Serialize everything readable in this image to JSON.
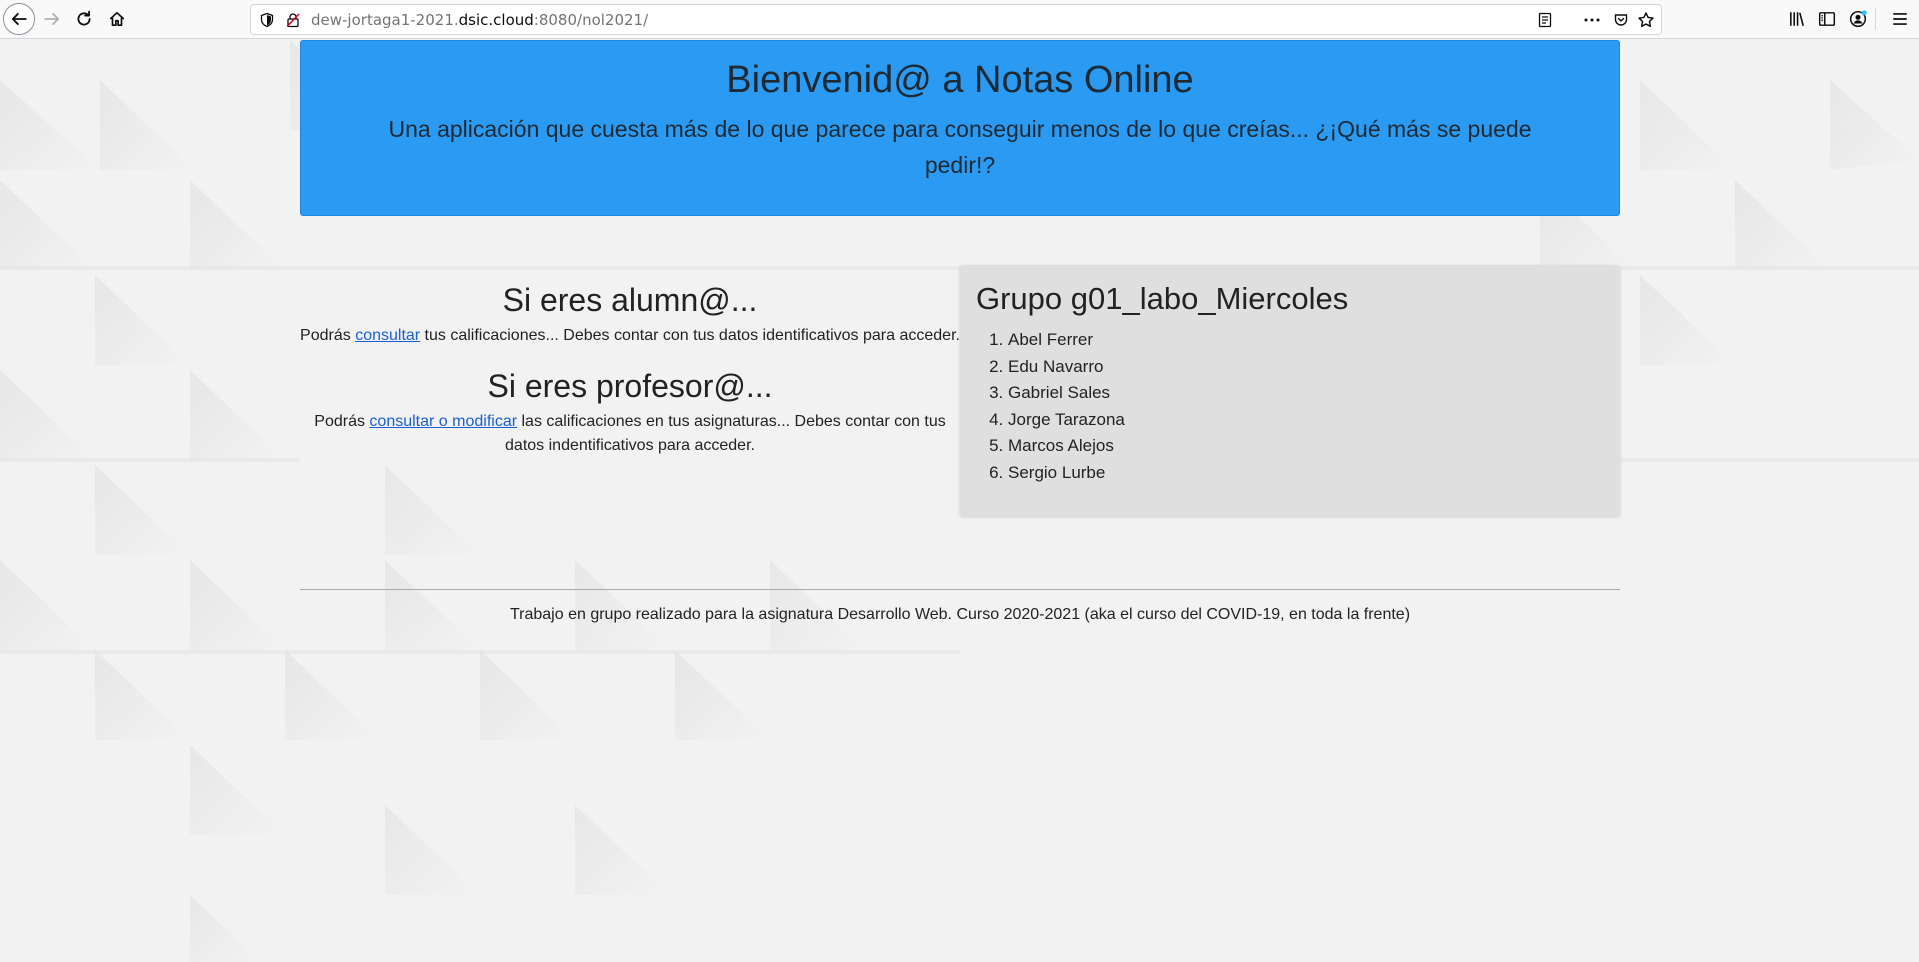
{
  "browser": {
    "url_prefix": "dew-jortaga1-2021.",
    "url_host": "dsic.cloud",
    "url_suffix": ":8080/nol2021/"
  },
  "hero": {
    "title": "Bienvenid@ a Notas Online",
    "subtitle": "Una aplicación que cuesta más de lo que parece para conseguir menos de lo que creías... ¿¡Qué más se puede pedir!?"
  },
  "alumno": {
    "heading": "Si eres alumn@...",
    "text_before": "Podrás ",
    "link": "consultar",
    "text_after": " tus calificaciones... Debes contar con tus datos identificativos para acceder."
  },
  "profesor": {
    "heading": "Si eres profesor@...",
    "text_before": "Podrás ",
    "link": "consultar o modificar",
    "text_after": " las calificaciones en tus asignaturas... Debes contar con tus datos indentificativos para acceder."
  },
  "group": {
    "title": "Grupo g01_labo_Miercoles",
    "members": [
      "Abel Ferrer",
      "Edu Navarro",
      "Gabriel Sales",
      "Jorge Tarazona",
      "Marcos Alejos",
      "Sergio Lurbe"
    ]
  },
  "footer": {
    "text": "Trabajo en grupo realizado para la asignatura Desarrollo Web. Curso 2020-2021 (aka el curso del COVID-19, en toda la frente)"
  },
  "colors": {
    "hero_bg": "#2b9af3",
    "link": "#1a5fd1",
    "panel_bg": "#e0dfdf"
  }
}
